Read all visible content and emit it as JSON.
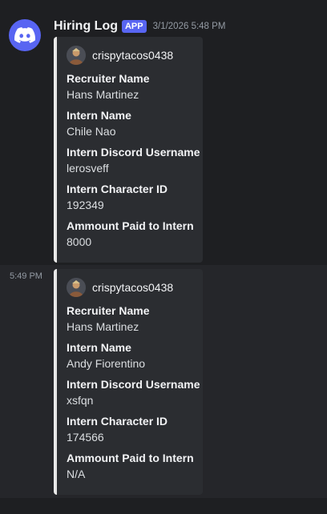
{
  "messages": [
    {
      "author": "Hiring Log",
      "badge": "APP",
      "timestamp": "3/1/2026 5:48 PM",
      "embed": {
        "author_name": "crispytacos0438",
        "fields": [
          {
            "name": "Recruiter Name",
            "value": "Hans Martinez"
          },
          {
            "name": "Intern Name",
            "value": "Chile Nao"
          },
          {
            "name": "Intern Discord Username",
            "value": "lerosveff"
          },
          {
            "name": "Intern Character ID",
            "value": "192349"
          },
          {
            "name": "Ammount Paid to Intern",
            "value": "8000"
          }
        ]
      }
    },
    {
      "timestamp": "5:49 PM",
      "embed": {
        "author_name": "crispytacos0438",
        "fields": [
          {
            "name": "Recruiter Name",
            "value": "Hans Martinez"
          },
          {
            "name": "Intern Name",
            "value": "Andy Fiorentino"
          },
          {
            "name": "Intern Discord Username",
            "value": "xsfqn"
          },
          {
            "name": "Intern Character ID",
            "value": "174566"
          },
          {
            "name": "Ammount Paid to Intern",
            "value": "N/A"
          }
        ]
      }
    }
  ],
  "icons": {
    "bot_avatar": "discord-logo-icon",
    "embed_avatar": "user-avatar-icon"
  },
  "colors": {
    "blurple": "#5865f2",
    "embed_border": "#e8e8e8",
    "embed_bg": "#2b2d31"
  }
}
